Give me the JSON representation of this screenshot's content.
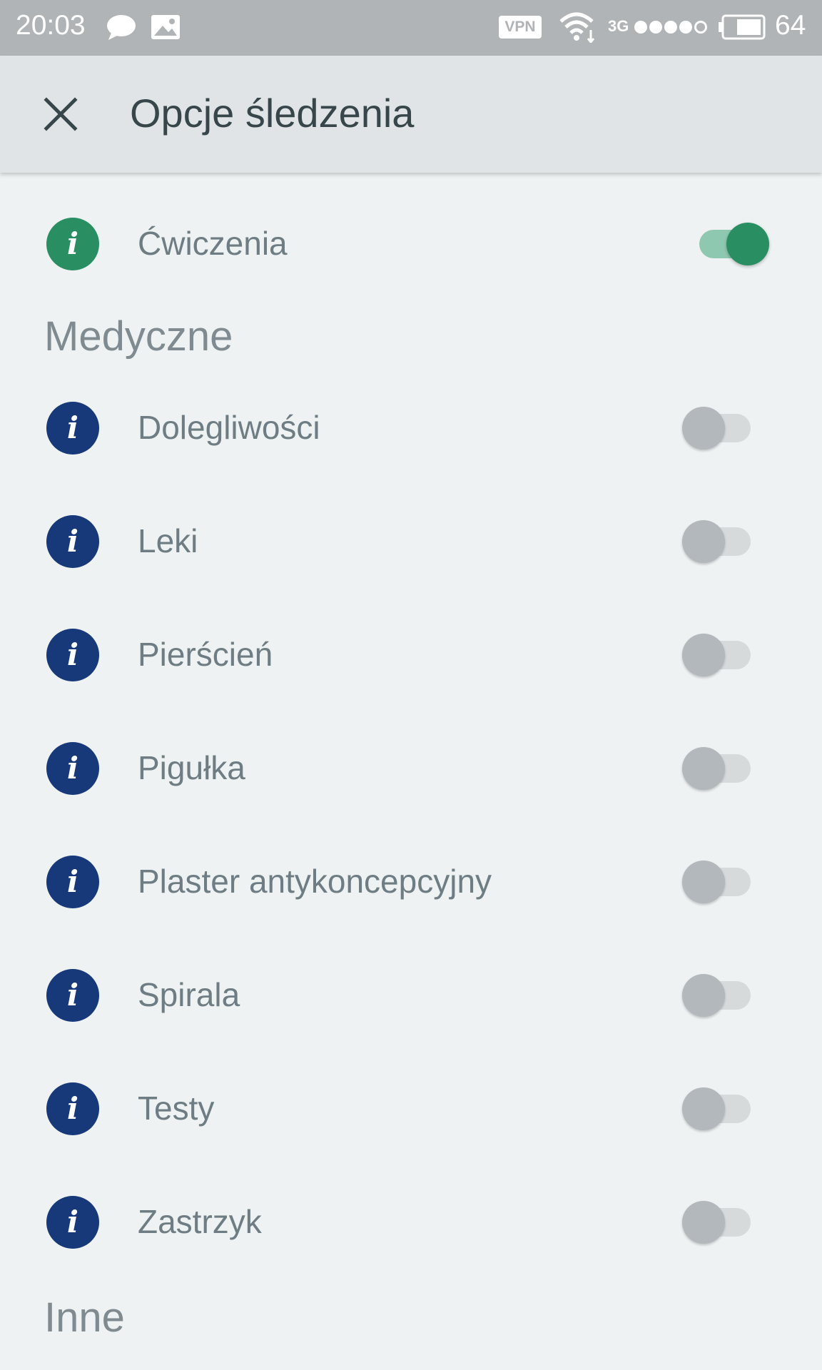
{
  "status_bar": {
    "time": "20:03",
    "vpn": "VPN",
    "network": "3G",
    "signal_dots_filled": 4,
    "signal_dots_total": 5,
    "battery_level": "64"
  },
  "app_bar": {
    "title": "Opcje śledzenia"
  },
  "colors": {
    "accent_green": "#2a8e63",
    "info_blue": "#17397a",
    "info_green": "#2a8e63"
  },
  "top_item": {
    "label": "Ćwiczenia",
    "enabled": true
  },
  "sections": {
    "medical": {
      "title": "Medyczne",
      "items": [
        {
          "label": "Dolegliwości",
          "enabled": false
        },
        {
          "label": "Leki",
          "enabled": false
        },
        {
          "label": "Pierścień",
          "enabled": false
        },
        {
          "label": "Pigułka",
          "enabled": false
        },
        {
          "label": "Plaster antykoncepcyjny",
          "enabled": false
        },
        {
          "label": "Spirala",
          "enabled": false
        },
        {
          "label": "Testy",
          "enabled": false
        },
        {
          "label": "Zastrzyk",
          "enabled": false
        }
      ]
    },
    "other": {
      "title": "Inne"
    }
  }
}
